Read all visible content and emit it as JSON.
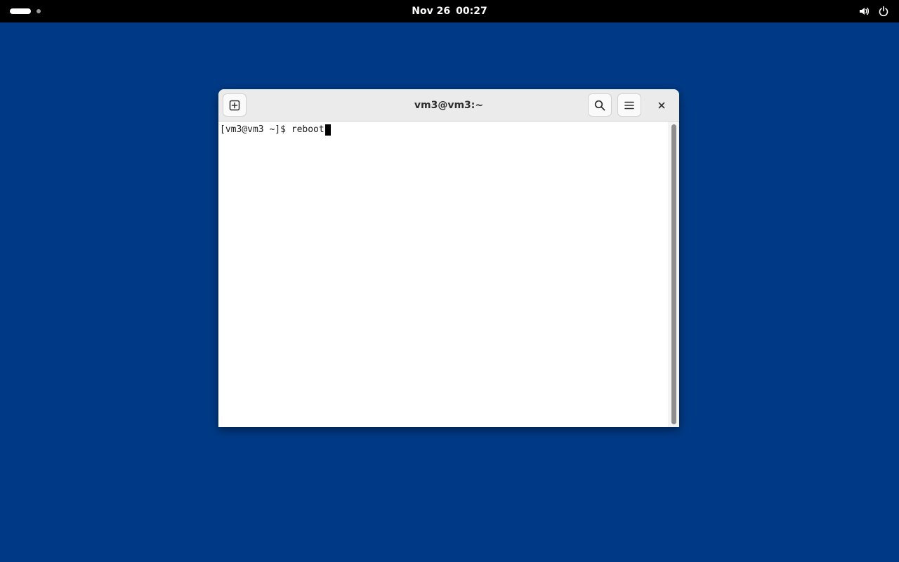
{
  "topbar": {
    "date": "Nov 26",
    "time": "00:27",
    "icons": [
      "workspace-indicator-icon",
      "volume-icon",
      "power-icon"
    ]
  },
  "window": {
    "title": "vm3@vm3:~",
    "buttons": [
      "new-tab-icon",
      "search-icon",
      "hamburger-menu-icon",
      "close-icon"
    ]
  },
  "terminal": {
    "prompt": "[vm3@vm3 ~]$ ",
    "command": "reboot"
  },
  "colors": {
    "desktop": "#003a86",
    "topbar": "#000000",
    "headerbar": "#ebebeb",
    "terminal_bg": "#ffffff"
  }
}
